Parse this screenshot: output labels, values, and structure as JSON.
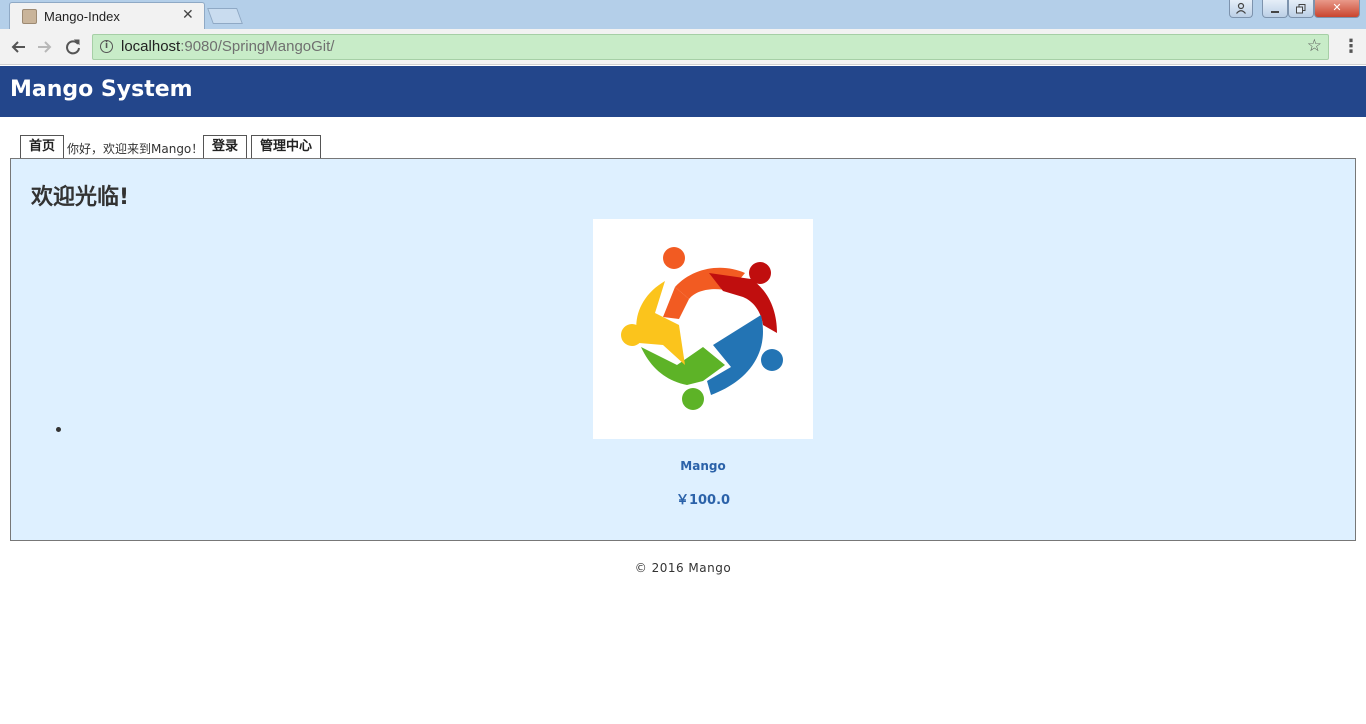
{
  "browser": {
    "tab_title": "Mango-Index",
    "tab_close": "✕",
    "url_host": "localhost",
    "url_path": ":9080/SpringMangoGit/",
    "window_close": "✕"
  },
  "header": {
    "title": "Mango System"
  },
  "nav": {
    "home": "首页",
    "welcome": "你好，欢迎来到Mango！",
    "login": "登录",
    "admin": "管理中心"
  },
  "main": {
    "heading": "欢迎光临!",
    "product": {
      "name": "Mango",
      "price": "￥100.0"
    }
  },
  "footer": {
    "copyright": "© 2016 Mango"
  },
  "colors": {
    "header_bg": "#23468b",
    "panel_bg": "#def0ff",
    "link": "#2b62a9",
    "logo_orange": "#f25b22",
    "logo_red": "#c00e0e",
    "logo_blue": "#2374b4",
    "logo_green": "#5db327",
    "logo_yellow": "#fbc41c"
  }
}
